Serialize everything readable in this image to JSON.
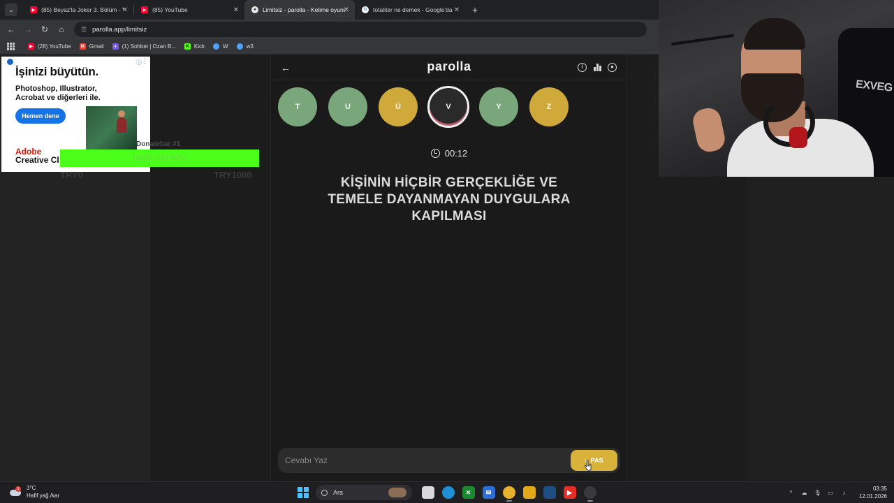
{
  "browser": {
    "tabs": [
      {
        "title": "(85) Beyaz'la Joker 3. Bölüm - Y",
        "icon": "youtube-icon",
        "active": false
      },
      {
        "title": "(85) YouTube",
        "icon": "youtube-icon",
        "active": false
      },
      {
        "title": "Limitsiz - parolla - Kelime oyunu",
        "icon": "parolla-icon",
        "active": true
      },
      {
        "title": "totaliter ne demek - Google'da",
        "icon": "google-icon",
        "active": false
      }
    ],
    "url": "parolla.app/limitsiz",
    "bookmarks": [
      {
        "label": "(28) YouTube",
        "icon": "youtube-icon",
        "color": "#ff0033"
      },
      {
        "label": "Gmail",
        "icon": "gmail-icon",
        "color": "#ea4335"
      },
      {
        "label": "(1) Sohbet | Ozan B...",
        "icon": "chat-icon",
        "color": "#7b5ae6"
      },
      {
        "label": "Kick",
        "icon": "kick-icon",
        "color": "#53fc18"
      },
      {
        "label": "W",
        "icon": "globe-icon",
        "color": "#4ea3ff"
      },
      {
        "label": "w3",
        "icon": "globe-icon",
        "color": "#4ea3ff"
      }
    ]
  },
  "ad": {
    "headline": "İşinizi büyütün.",
    "body": "Photoshop, Illustrator, Acrobat ve diğerleri ile.",
    "cta": "Hemen dene",
    "brand_line1": "Adobe",
    "brand_line2": "Creative Cl"
  },
  "donate": {
    "title": "Donatebar #1",
    "progress_text": "1000₺ (100.00%)",
    "progress_fraction": 1.0,
    "min_label": "TRY0",
    "max_label": "TRY1000",
    "bar_color": "#4cff1a"
  },
  "game": {
    "logo": "parolla",
    "letters": [
      {
        "char": "T",
        "state": "correct"
      },
      {
        "char": "U",
        "state": "correct"
      },
      {
        "char": "Ü",
        "state": "passed"
      },
      {
        "char": "V",
        "state": "current"
      },
      {
        "char": "Y",
        "state": "correct"
      },
      {
        "char": "Z",
        "state": "passed"
      }
    ],
    "timer": "00:12",
    "question": "KİŞİNİN HİÇBİR GERÇEKLİĞE VE TEMELE DAYANMAYAN DUYGULARA KAPILMASI",
    "answer_placeholder": "Cevabı Yaz",
    "pass_label": "PAS",
    "colors": {
      "correct": "#7aa67c",
      "passed": "#cfaa3b",
      "pass_button": "#d9b23a"
    }
  },
  "webcam": {
    "chair_text": "EXVEG"
  },
  "taskbar": {
    "weather_temp": "3°C",
    "weather_desc": "Hafif yağ./kar",
    "weather_badge": "1",
    "search_label": "Ara",
    "time": "03:35",
    "date": "12.01.2026"
  }
}
